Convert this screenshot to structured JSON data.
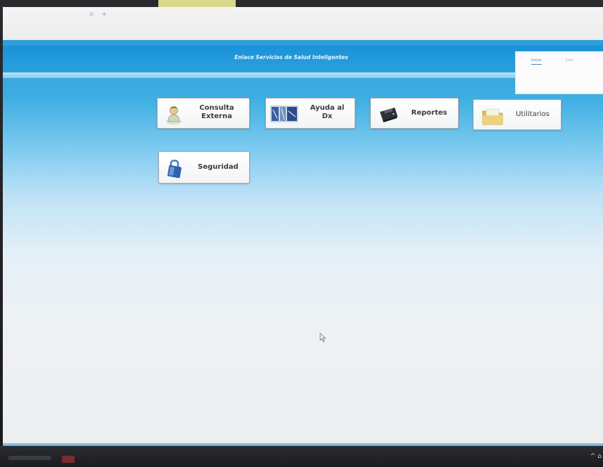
{
  "browser": {
    "tab_title": "",
    "address_text": ""
  },
  "header": {
    "title": "Enlace Servicios de Salud Inteligentes"
  },
  "user_panel": {
    "link_primary": "Inicio",
    "link_secondary": "Salir",
    "user_info": ""
  },
  "menu": {
    "buttons": [
      {
        "line1": "Consulta",
        "line2": "Externa",
        "icon": "user-icon"
      },
      {
        "line1": "Ayuda al",
        "line2": "Dx",
        "icon": "diagnosis-image-icon"
      },
      {
        "line1": "Reportes",
        "line2": "",
        "icon": "printer-icon"
      },
      {
        "line1": "Utilitarios",
        "line2": "",
        "icon": "folder-icon"
      },
      {
        "line1": "Seguridad",
        "line2": "",
        "icon": "lock-icon"
      }
    ]
  },
  "taskbar": {
    "tray_text": "^ ⌂"
  },
  "colors": {
    "header_blue": "#1a92d6",
    "button_border": "#a4a7ab",
    "label_text": "#3a3d42"
  }
}
